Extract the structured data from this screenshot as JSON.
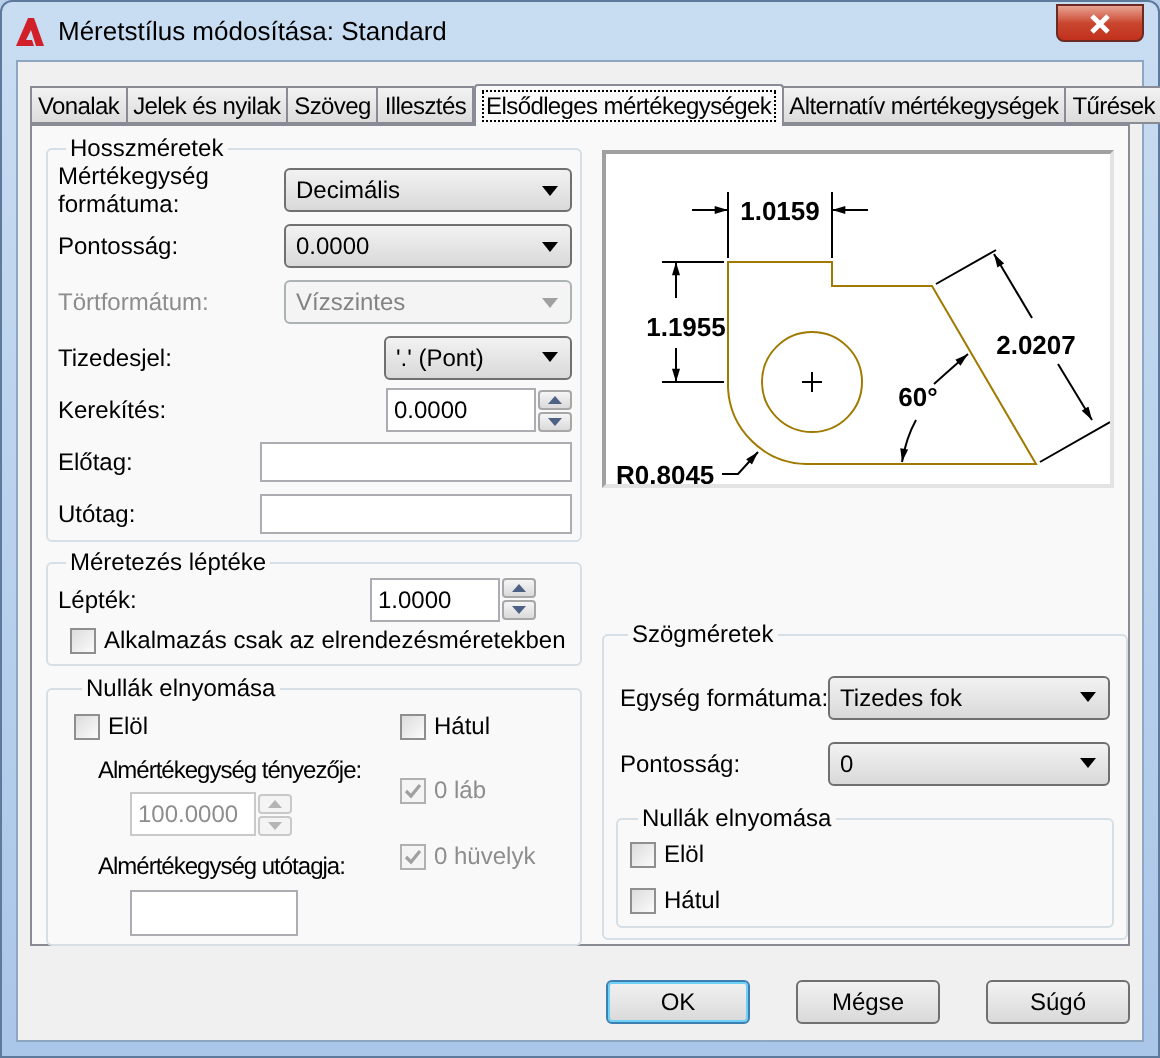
{
  "window": {
    "title": "Méretstílus módosítása: Standard"
  },
  "tabs": [
    {
      "label": "Vonalak",
      "selected": false
    },
    {
      "label": "Jelek és nyilak",
      "selected": false
    },
    {
      "label": "Szöveg",
      "selected": false
    },
    {
      "label": "Illesztés",
      "selected": false
    },
    {
      "label": "Elsődleges mértékegységek",
      "selected": true
    },
    {
      "label": "Alternatív mértékegységek",
      "selected": false
    },
    {
      "label": "Tűrések",
      "selected": false
    }
  ],
  "linear": {
    "title": "Hosszméretek",
    "fields": [
      {
        "kind": "select",
        "label": "Mértékegység formátuma:",
        "value": "Decimális",
        "disabled": false
      },
      {
        "kind": "select",
        "label": "Pontosság:",
        "value": "0.0000",
        "disabled": false
      },
      {
        "kind": "select",
        "label": "Törtformátum:",
        "value": "Vízszintes",
        "disabled": true
      },
      {
        "kind": "select-short",
        "label": "Tizedesjel:",
        "value": "'.' (Pont)",
        "disabled": false
      },
      {
        "kind": "spinner",
        "label": "Kerekítés:",
        "value": "0.0000",
        "disabled": false
      },
      {
        "kind": "text",
        "label": "Előtag:"
      },
      {
        "kind": "text",
        "label": "Utótag:"
      }
    ]
  },
  "scale": {
    "title": "Méretezés léptéke",
    "label": "Lépték:",
    "value": "1.0000",
    "layout_only": {
      "label": "Alkalmazás csak az elrendezésméretekben",
      "checked": false,
      "disabled": false
    }
  },
  "zero_suppression": {
    "title": "Nullák elnyomása",
    "leading": {
      "label": "Elöl",
      "checked": false,
      "disabled": false
    },
    "trailing": {
      "label": "Hátul",
      "checked": false,
      "disabled": false
    },
    "subunit_factor": {
      "label": "Almértékegység tényezője:",
      "value": "100.0000",
      "disabled": true
    },
    "subunit_suffix": {
      "label": "Almértékegység utótagja:"
    },
    "feet": {
      "label": "0 láb",
      "checked": true,
      "disabled": true
    },
    "inches": {
      "label": "0 hüvelyk",
      "checked": true,
      "disabled": true
    }
  },
  "preview": {
    "labels": [
      "1.0159",
      "1.1955",
      "2.0207",
      "60°",
      "R0.8045"
    ]
  },
  "angular": {
    "title": "Szögméretek",
    "fields": [
      {
        "label": "Egység formátuma:",
        "value": "Tizedes fok",
        "disabled": false
      },
      {
        "label": "Pontosság:",
        "value": "0",
        "disabled": false
      }
    ],
    "zero_suppression": {
      "title": "Nullák elnyomása",
      "options": [
        {
          "label": "Elöl",
          "checked": false,
          "disabled": false
        },
        {
          "label": "Hátul",
          "checked": false,
          "disabled": false
        }
      ]
    }
  },
  "buttons": [
    {
      "label": "OK",
      "default": true
    },
    {
      "label": "Mégse",
      "default": false
    },
    {
      "label": "Súgó",
      "default": false
    }
  ]
}
